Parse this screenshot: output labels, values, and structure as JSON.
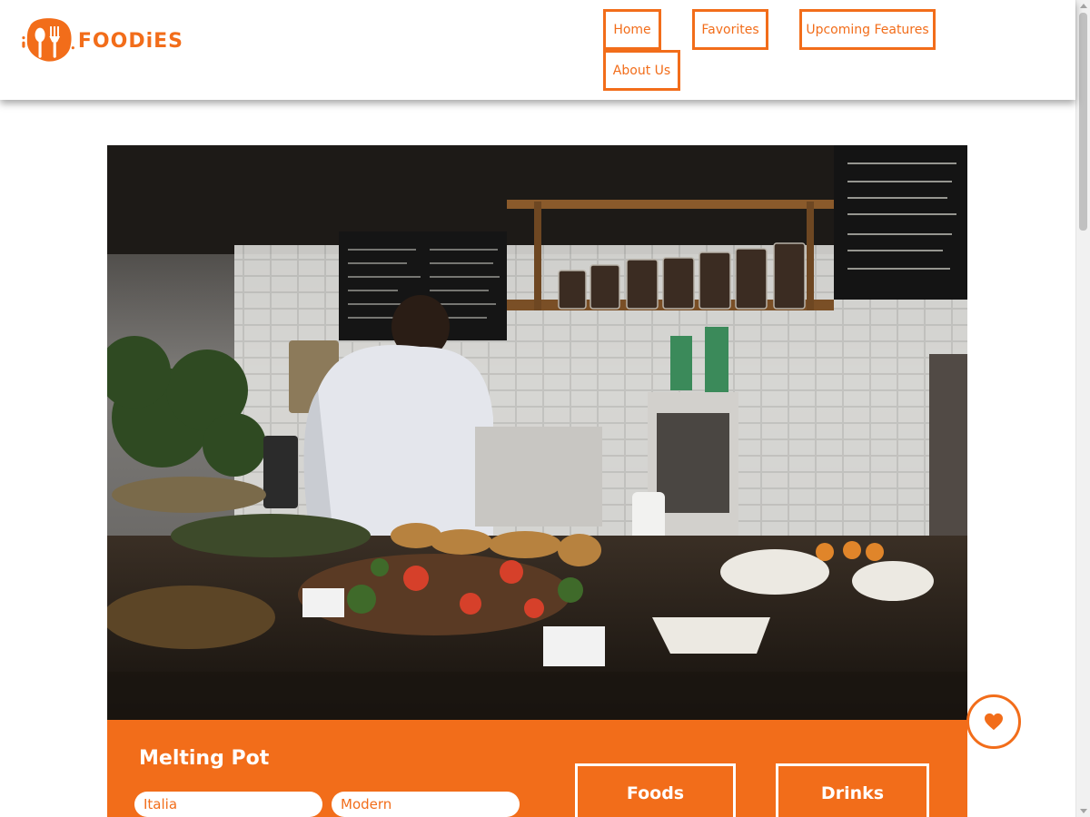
{
  "brand": {
    "name": "FOODiES",
    "accent_color": "#f26d1a"
  },
  "nav": {
    "home": "Home",
    "favorites": "Favorites",
    "upcoming": "Upcoming Features",
    "about": "About Us"
  },
  "card": {
    "title": "Melting Pot",
    "tags": [
      "Italia",
      "Modern"
    ],
    "foods_label": "Foods",
    "drinks_label": "Drinks",
    "favorite_icon": "heart-icon",
    "photo": "cafe-counter-photo"
  }
}
